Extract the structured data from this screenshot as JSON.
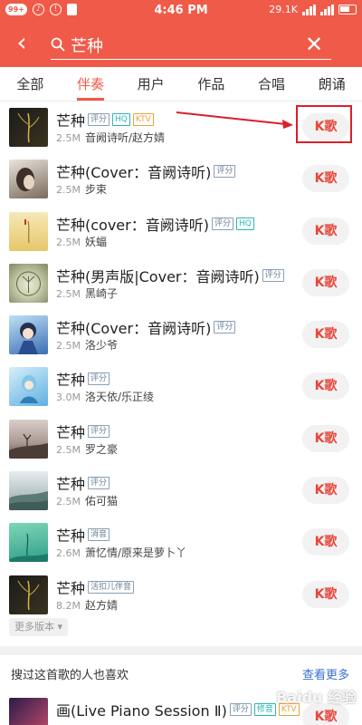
{
  "status_bar": {
    "badge": "99+",
    "time": "4:46 PM",
    "speed": "29.1K"
  },
  "search": {
    "query": "芒种",
    "back_icon": "chevron-left-icon",
    "search_icon": "search-icon",
    "clear_icon": "close-icon"
  },
  "tabs": [
    {
      "label": "全部"
    },
    {
      "label": "伴奏"
    },
    {
      "label": "用户"
    },
    {
      "label": "作品"
    },
    {
      "label": "合唱"
    },
    {
      "label": "朗诵"
    }
  ],
  "active_tab": "伴奏",
  "k_label": "K歌",
  "songs": [
    {
      "title": "芒种",
      "tags": [
        "评分",
        "HQ",
        "KTV"
      ],
      "size": "2.5M",
      "artist": "音阙诗听/赵方婧"
    },
    {
      "title": "芒种(Cover：音阙诗听)",
      "tags": [
        "评分"
      ],
      "size": "2.5M",
      "artist": "步束"
    },
    {
      "title": "芒种(cover：音阙诗听)",
      "tags": [
        "评分",
        "HQ"
      ],
      "size": "2.5M",
      "artist": "妖蝠"
    },
    {
      "title": "芒种(男声版|Cover：音阙诗听)",
      "tags": [
        "评分"
      ],
      "size": "2.5M",
      "artist": "黑崎子"
    },
    {
      "title": "芒种(Cover：音阙诗听)",
      "tags": [
        "评分"
      ],
      "size": "2.5M",
      "artist": "洛少爷"
    },
    {
      "title": "芒种",
      "tags": [
        "评分"
      ],
      "size": "3.0M",
      "artist": "洛天依/乐正绫"
    },
    {
      "title": "芒种",
      "tags": [
        "评分"
      ],
      "size": "2.5M",
      "artist": "罗之豪"
    },
    {
      "title": "芒种",
      "tags": [
        "评分"
      ],
      "size": "2.5M",
      "artist": "佑可猫"
    },
    {
      "title": "芒种",
      "tags": [
        "消音"
      ],
      "size": "2.6M",
      "artist": "萧忆情/原来是萝卜丫"
    },
    {
      "title": "芒种",
      "tags": [
        "活扣儿伴音"
      ],
      "size": "8.2M",
      "artist": "赵方婧"
    }
  ],
  "more_versions": "更多版本 ▾",
  "section": {
    "title": "搜过这首歌的人也喜欢",
    "more": "查看更多"
  },
  "next_song": {
    "title": "画(Live Piano Session Ⅱ)",
    "tags": [
      "评分",
      "修音",
      "KTV"
    ]
  },
  "watermark": "Baidu 经验",
  "colors": {
    "brand": "#f05a48",
    "k_text": "#e8463a",
    "annotation": "#d8202a"
  }
}
